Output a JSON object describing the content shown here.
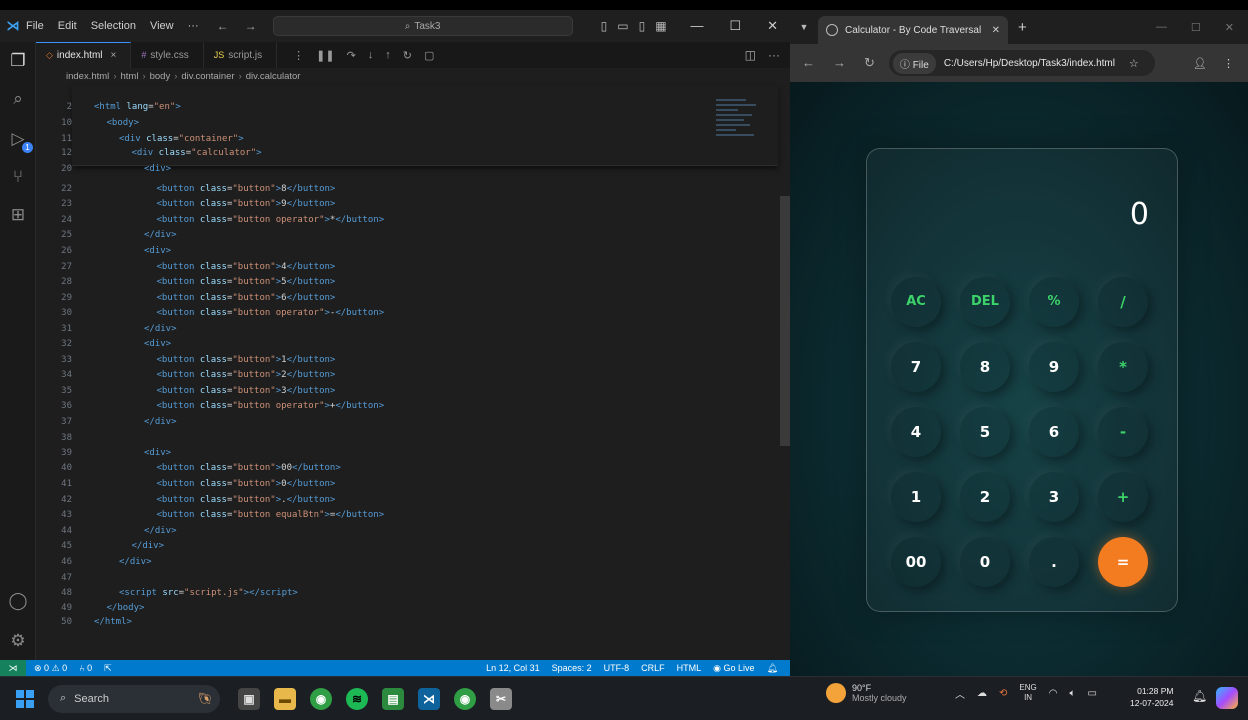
{
  "vscode": {
    "menu": [
      "File",
      "Edit",
      "Selection",
      "View",
      "···"
    ],
    "search_label": "Task3",
    "tabs": [
      {
        "label": "index.html",
        "type": "html"
      },
      {
        "label": "style.css",
        "type": "css"
      },
      {
        "label": "script.js",
        "type": "js"
      }
    ],
    "breadcrumb": [
      "index.html",
      "html",
      "body",
      "div.container",
      "div.calculator"
    ],
    "lines": [
      {
        "n": "2",
        "indent": 0,
        "html": "<span class='tag'>&lt;html</span> <span class='attr'>lang</span>=<span class='str'>\"en\"</span><span class='tag'>&gt;</span>"
      },
      {
        "n": "10",
        "indent": 1,
        "html": "<span class='tag'>&lt;body&gt;</span>"
      },
      {
        "n": "11",
        "indent": 2,
        "html": "<span class='tag'>&lt;div</span> <span class='attr'>class</span>=<span class='str'>\"container\"</span><span class='tag'>&gt;</span>"
      },
      {
        "n": "12",
        "indent": 3,
        "html": "<span class='tag'>&lt;div</span> <span class='attr'>class</span>=<span class='str'>\"calculator\"</span><span class='tag'>&gt;</span>"
      },
      {
        "n": "20",
        "indent": 4,
        "html": "<span class='tag'>&lt;div&gt;</span>"
      },
      {
        "n": "22",
        "indent": 5,
        "html": "<span class='tag'>&lt;button</span> <span class='attr'>class</span>=<span class='str'>\"button\"</span><span class='tag'>&gt;</span>8<span class='tag'>&lt;/button&gt;</span>"
      },
      {
        "n": "23",
        "indent": 5,
        "html": "<span class='tag'>&lt;button</span> <span class='attr'>class</span>=<span class='str'>\"button\"</span><span class='tag'>&gt;</span>9<span class='tag'>&lt;/button&gt;</span>"
      },
      {
        "n": "24",
        "indent": 5,
        "html": "<span class='tag'>&lt;button</span> <span class='attr'>class</span>=<span class='str'>\"button operator\"</span><span class='tag'>&gt;</span>*<span class='tag'>&lt;/button&gt;</span>"
      },
      {
        "n": "25",
        "indent": 4,
        "html": "<span class='tag'>&lt;/div&gt;</span>"
      },
      {
        "n": "26",
        "indent": 4,
        "html": "<span class='tag'>&lt;div&gt;</span>"
      },
      {
        "n": "27",
        "indent": 5,
        "html": "<span class='tag'>&lt;button</span> <span class='attr'>class</span>=<span class='str'>\"button\"</span><span class='tag'>&gt;</span>4<span class='tag'>&lt;/button&gt;</span>"
      },
      {
        "n": "28",
        "indent": 5,
        "html": "<span class='tag'>&lt;button</span> <span class='attr'>class</span>=<span class='str'>\"button\"</span><span class='tag'>&gt;</span>5<span class='tag'>&lt;/button&gt;</span>"
      },
      {
        "n": "29",
        "indent": 5,
        "html": "<span class='tag'>&lt;button</span> <span class='attr'>class</span>=<span class='str'>\"button\"</span><span class='tag'>&gt;</span>6<span class='tag'>&lt;/button&gt;</span>"
      },
      {
        "n": "30",
        "indent": 5,
        "html": "<span class='tag'>&lt;button</span> <span class='attr'>class</span>=<span class='str'>\"button operator\"</span><span class='tag'>&gt;</span>-<span class='tag'>&lt;/button&gt;</span>"
      },
      {
        "n": "31",
        "indent": 4,
        "html": "<span class='tag'>&lt;/div&gt;</span>"
      },
      {
        "n": "32",
        "indent": 4,
        "html": "<span class='tag'>&lt;div&gt;</span>"
      },
      {
        "n": "33",
        "indent": 5,
        "html": "<span class='tag'>&lt;button</span> <span class='attr'>class</span>=<span class='str'>\"button\"</span><span class='tag'>&gt;</span>1<span class='tag'>&lt;/button&gt;</span>"
      },
      {
        "n": "34",
        "indent": 5,
        "html": "<span class='tag'>&lt;button</span> <span class='attr'>class</span>=<span class='str'>\"button\"</span><span class='tag'>&gt;</span>2<span class='tag'>&lt;/button&gt;</span>"
      },
      {
        "n": "35",
        "indent": 5,
        "html": "<span class='tag'>&lt;button</span> <span class='attr'>class</span>=<span class='str'>\"button\"</span><span class='tag'>&gt;</span>3<span class='tag'>&lt;/button&gt;</span>"
      },
      {
        "n": "36",
        "indent": 5,
        "html": "<span class='tag'>&lt;button</span> <span class='attr'>class</span>=<span class='str'>\"button operator\"</span><span class='tag'>&gt;</span>+<span class='tag'>&lt;/button&gt;</span>"
      },
      {
        "n": "37",
        "indent": 4,
        "html": "<span class='tag'>&lt;/div&gt;</span>"
      },
      {
        "n": "38",
        "indent": 4,
        "html": ""
      },
      {
        "n": "39",
        "indent": 4,
        "html": "<span class='tag'>&lt;div&gt;</span>"
      },
      {
        "n": "40",
        "indent": 5,
        "html": "<span class='tag'>&lt;button</span> <span class='attr'>class</span>=<span class='str'>\"button\"</span><span class='tag'>&gt;</span>00<span class='tag'>&lt;/button&gt;</span>"
      },
      {
        "n": "41",
        "indent": 5,
        "html": "<span class='tag'>&lt;button</span> <span class='attr'>class</span>=<span class='str'>\"button\"</span><span class='tag'>&gt;</span>0<span class='tag'>&lt;/button&gt;</span>"
      },
      {
        "n": "42",
        "indent": 5,
        "html": "<span class='tag'>&lt;button</span> <span class='attr'>class</span>=<span class='str'>\"button\"</span><span class='tag'>&gt;</span>.<span class='tag'>&lt;/button&gt;</span>"
      },
      {
        "n": "43",
        "indent": 5,
        "html": "<span class='tag'>&lt;button</span> <span class='attr'>class</span>=<span class='str'>\"button equalBtn\"</span><span class='tag'>&gt;</span>=<span class='tag'>&lt;/button&gt;</span>"
      },
      {
        "n": "44",
        "indent": 4,
        "html": "<span class='tag'>&lt;/div&gt;</span>"
      },
      {
        "n": "45",
        "indent": 3,
        "html": "<span class='tag'>&lt;/div&gt;</span>"
      },
      {
        "n": "46",
        "indent": 2,
        "html": "<span class='tag'>&lt;/div&gt;</span>"
      },
      {
        "n": "47",
        "indent": 2,
        "html": ""
      },
      {
        "n": "48",
        "indent": 2,
        "html": "<span class='tag'>&lt;script</span> <span class='attr'>src</span>=<span class='str'>\"script.js\"</span><span class='tag'>&gt;&lt;/script&gt;</span>"
      },
      {
        "n": "49",
        "indent": 1,
        "html": "<span class='tag'>&lt;/body&gt;</span>"
      },
      {
        "n": "50",
        "indent": 0,
        "html": "<span class='tag'>&lt;/html&gt;</span>"
      }
    ],
    "status": {
      "errors": "0",
      "warnings": "0",
      "ports": "0",
      "position": "Ln 12, Col 31",
      "spaces": "Spaces: 2",
      "encoding": "UTF-8",
      "eol": "CRLF",
      "language": "HTML",
      "golive": "Go Live"
    }
  },
  "chrome": {
    "tab_title": "Calculator - By Code Traversal",
    "url_chip": "File",
    "url": "C:/Users/Hp/Desktop/Task3/index.html"
  },
  "calculator": {
    "display": "0",
    "rows": [
      [
        {
          "label": "AC",
          "kind": "top"
        },
        {
          "label": "DEL",
          "kind": "top"
        },
        {
          "label": "%",
          "kind": "top"
        },
        {
          "label": "/",
          "kind": "op"
        }
      ],
      [
        {
          "label": "7",
          "kind": "num"
        },
        {
          "label": "8",
          "kind": "num"
        },
        {
          "label": "9",
          "kind": "num"
        },
        {
          "label": "*",
          "kind": "op"
        }
      ],
      [
        {
          "label": "4",
          "kind": "num"
        },
        {
          "label": "5",
          "kind": "num"
        },
        {
          "label": "6",
          "kind": "num"
        },
        {
          "label": "-",
          "kind": "op"
        }
      ],
      [
        {
          "label": "1",
          "kind": "num"
        },
        {
          "label": "2",
          "kind": "num"
        },
        {
          "label": "3",
          "kind": "num"
        },
        {
          "label": "+",
          "kind": "op"
        }
      ],
      [
        {
          "label": "00",
          "kind": "num"
        },
        {
          "label": "0",
          "kind": "num"
        },
        {
          "label": ".",
          "kind": "num"
        },
        {
          "label": "=",
          "kind": "eq"
        }
      ]
    ],
    "colors": {
      "operator": "#3cd36a",
      "equal": "#f47c20"
    }
  },
  "taskbar": {
    "search_label": "Search",
    "weather_temp": "90°F",
    "weather_desc": "Mostly cloudy",
    "lang_top": "ENG",
    "lang_bottom": "IN",
    "time": "01:28 PM",
    "date": "12-07-2024"
  }
}
